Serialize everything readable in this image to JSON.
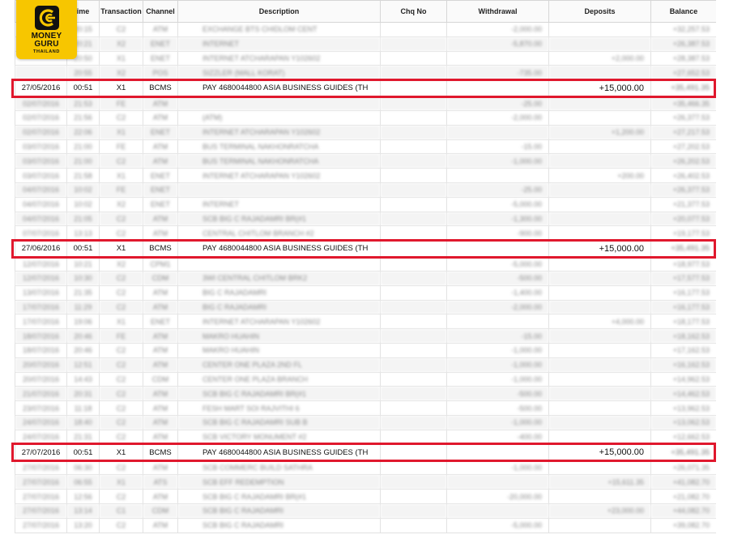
{
  "brand": {
    "line1": "MONEY",
    "line2": "GURU",
    "line3": "THAILAND"
  },
  "headers": [
    "ime",
    "Transaction",
    "Channel",
    "Description",
    "Chq No",
    "Withdrawal",
    "Deposits",
    "Balance"
  ],
  "colors": {
    "highlight": "#e0182d",
    "brand": "#f7c600"
  },
  "rows": [
    {
      "date": "",
      "time": "20:15",
      "trn": "C2",
      "chn": "ATM",
      "desc": "EXCHANGE BTS CHIDLOM CENT",
      "chq": "",
      "wd": "-2,000.00",
      "dep": "",
      "bal": "+32,257.53",
      "hl": false
    },
    {
      "date": "",
      "time": "20:21",
      "trn": "X2",
      "chn": "ENET",
      "desc": "INTERNET",
      "chq": "",
      "wd": "-5,870.00",
      "dep": "",
      "bal": "+26,387.53",
      "hl": false
    },
    {
      "date": "",
      "time": "20:50",
      "trn": "X1",
      "chn": "ENET",
      "desc": "INTERNET ATCHARAPAN Y102602",
      "chq": "",
      "wd": "",
      "dep": "+2,000.00",
      "bal": "+28,387.53",
      "hl": false
    },
    {
      "date": "",
      "time": "20:55",
      "trn": "X2",
      "chn": "POS",
      "desc": "SIZZLER (MALL KORAT)",
      "chq": "",
      "wd": "-735.00",
      "dep": "",
      "bal": "+27,652.53",
      "hl": false
    },
    {
      "date": "27/05/2016",
      "time": "00:51",
      "trn": "X1",
      "chn": "BCMS",
      "desc": "PAY 4680044800 ASIA BUSINESS GUIDES (TH",
      "chq": "",
      "wd": "",
      "dep": "+15,000.00",
      "bal": "+35,491.35",
      "hl": true
    },
    {
      "date": "02/07/2016",
      "time": "21:53",
      "trn": "FE",
      "chn": "ATM",
      "desc": "",
      "chq": "",
      "wd": "-25.00",
      "dep": "",
      "bal": "+35,466.35",
      "hl": false
    },
    {
      "date": "02/07/2016",
      "time": "21:56",
      "trn": "C2",
      "chn": "ATM",
      "desc": "(ATM)",
      "chq": "",
      "wd": "-2,000.00",
      "dep": "",
      "bal": "+26,377.53",
      "hl": false
    },
    {
      "date": "02/07/2016",
      "time": "22:06",
      "trn": "X1",
      "chn": "ENET",
      "desc": "INTERNET ATCHARAPAN Y102602",
      "chq": "",
      "wd": "",
      "dep": "+1,200.00",
      "bal": "+27,217.53",
      "hl": false
    },
    {
      "date": "03/07/2016",
      "time": "21:00",
      "trn": "FE",
      "chn": "ATM",
      "desc": "BUS TERMINAL NAKHONRATCHA",
      "chq": "",
      "wd": "-15.00",
      "dep": "",
      "bal": "+27,202.53",
      "hl": false
    },
    {
      "date": "03/07/2016",
      "time": "21:00",
      "trn": "C2",
      "chn": "ATM",
      "desc": "BUS TERMINAL NAKHONRATCHA",
      "chq": "",
      "wd": "-1,000.00",
      "dep": "",
      "bal": "+26,202.53",
      "hl": false
    },
    {
      "date": "03/07/2016",
      "time": "21:58",
      "trn": "X1",
      "chn": "ENET",
      "desc": "INTERNET ATCHARAPAN Y102602",
      "chq": "",
      "wd": "",
      "dep": "+200.00",
      "bal": "+26,402.53",
      "hl": false
    },
    {
      "date": "04/07/2016",
      "time": "10:02",
      "trn": "FE",
      "chn": "ENET",
      "desc": "",
      "chq": "",
      "wd": "-25.00",
      "dep": "",
      "bal": "+26,377.53",
      "hl": false
    },
    {
      "date": "04/07/2016",
      "time": "10:02",
      "trn": "X2",
      "chn": "ENET",
      "desc": "INTERNET",
      "chq": "",
      "wd": "-5,000.00",
      "dep": "",
      "bal": "+21,377.53",
      "hl": false
    },
    {
      "date": "04/07/2016",
      "time": "21:05",
      "trn": "C2",
      "chn": "ATM",
      "desc": "SCB BIG C RAJADAMRI BR(#1",
      "chq": "",
      "wd": "-1,300.00",
      "dep": "",
      "bal": "+20,077.53",
      "hl": false
    },
    {
      "date": "07/07/2016",
      "time": "13:13",
      "trn": "C2",
      "chn": "ATM",
      "desc": "CENTRAL CHITLOM BRANCH #2",
      "chq": "",
      "wd": "-900.00",
      "dep": "",
      "bal": "+19,177.53",
      "hl": false
    },
    {
      "date": "27/06/2016",
      "time": "00:51",
      "trn": "X1",
      "chn": "BCMS",
      "desc": "PAY 4680044800 ASIA BUSINESS GUIDES (TH",
      "chq": "",
      "wd": "",
      "dep": "+15,000.00",
      "bal": "+35,491.35",
      "hl": true
    },
    {
      "date": "12/07/2016",
      "time": "10:21",
      "trn": "X2",
      "chn": "CPM1",
      "desc": "",
      "chq": "",
      "wd": "-5,000.00",
      "dep": "",
      "bal": "+18,977.53",
      "hl": false
    },
    {
      "date": "12/07/2016",
      "time": "10:30",
      "trn": "C2",
      "chn": "CDM",
      "desc": "3WI CENTRAL CHITLOM BRK2",
      "chq": "",
      "wd": "-500.00",
      "dep": "",
      "bal": "+17,577.53",
      "hl": false
    },
    {
      "date": "13/07/2016",
      "time": "21:35",
      "trn": "C2",
      "chn": "ATM",
      "desc": "BIG C RAJADAMRI",
      "chq": "",
      "wd": "-1,400.00",
      "dep": "",
      "bal": "+16,177.53",
      "hl": false
    },
    {
      "date": "17/07/2016",
      "time": "11:29",
      "trn": "C2",
      "chn": "ATM",
      "desc": "BIG C RAJADAMRI",
      "chq": "",
      "wd": "-2,000.00",
      "dep": "",
      "bal": "+16,177.53",
      "hl": false
    },
    {
      "date": "17/07/2016",
      "time": "19:06",
      "trn": "X1",
      "chn": "ENET",
      "desc": "INTERNET ATCHARAPAN Y102602",
      "chq": "",
      "wd": "",
      "dep": "+4,000.00",
      "bal": "+18,177.53",
      "hl": false
    },
    {
      "date": "18/07/2016",
      "time": "20:46",
      "trn": "FE",
      "chn": "ATM",
      "desc": "MAKRO HUAHIN",
      "chq": "",
      "wd": "-15.00",
      "dep": "",
      "bal": "+18,162.53",
      "hl": false
    },
    {
      "date": "18/07/2016",
      "time": "20:46",
      "trn": "C2",
      "chn": "ATM",
      "desc": "MAKRO HUAHIN",
      "chq": "",
      "wd": "-1,000.00",
      "dep": "",
      "bal": "+17,162.53",
      "hl": false
    },
    {
      "date": "20/07/2016",
      "time": "12:51",
      "trn": "C2",
      "chn": "ATM",
      "desc": "CENTER ONE PLAZA 2ND FL",
      "chq": "",
      "wd": "-1,000.00",
      "dep": "",
      "bal": "+16,162.53",
      "hl": false
    },
    {
      "date": "20/07/2016",
      "time": "14:43",
      "trn": "C2",
      "chn": "CDM",
      "desc": "CENTER ONE PLAZA BRANCH",
      "chq": "",
      "wd": "-1,000.00",
      "dep": "",
      "bal": "+14,962.53",
      "hl": false
    },
    {
      "date": "21/07/2016",
      "time": "20:31",
      "trn": "C2",
      "chn": "ATM",
      "desc": "SCB BIG C RAJADAMRI BR(#1",
      "chq": "",
      "wd": "-500.00",
      "dep": "",
      "bal": "+14,462.53",
      "hl": false
    },
    {
      "date": "23/07/2016",
      "time": "11:18",
      "trn": "C2",
      "chn": "ATM",
      "desc": "FESH MART SOI RAJVITHI 6",
      "chq": "",
      "wd": "-500.00",
      "dep": "",
      "bal": "+13,962.53",
      "hl": false
    },
    {
      "date": "24/07/2016",
      "time": "18:40",
      "trn": "C2",
      "chn": "ATM",
      "desc": "SCB BIG C RAJADAMRI SUB B",
      "chq": "",
      "wd": "-1,000.00",
      "dep": "",
      "bal": "+13,062.53",
      "hl": false
    },
    {
      "date": "24/07/2016",
      "time": "21:31",
      "trn": "C2",
      "chn": "ATM",
      "desc": "SCB VICTORY MONUMENT #2",
      "chq": "",
      "wd": "-400.00",
      "dep": "",
      "bal": "+12,662.53",
      "hl": false
    },
    {
      "date": "27/07/2016",
      "time": "00:51",
      "trn": "X1",
      "chn": "BCMS",
      "desc": "PAY 4680044800 ASIA BUSINESS GUIDES (TH",
      "chq": "",
      "wd": "",
      "dep": "+15,000.00",
      "bal": "+35,491.35",
      "hl": true
    },
    {
      "date": "27/07/2016",
      "time": "06:30",
      "trn": "C2",
      "chn": "ATM",
      "desc": "SCB COMMERC BUILD SATHRA",
      "chq": "",
      "wd": "-1,000.00",
      "dep": "",
      "bal": "+26,071.35",
      "hl": false
    },
    {
      "date": "27/07/2016",
      "time": "06:55",
      "trn": "X1",
      "chn": "ATS",
      "desc": "SCB EFF REDEMPTION",
      "chq": "",
      "wd": "",
      "dep": "+15,611.35",
      "bal": "+41,082.70",
      "hl": false
    },
    {
      "date": "27/07/2016",
      "time": "12:56",
      "trn": "C2",
      "chn": "ATM",
      "desc": "SCB BIG C RAJADAMRI BR(#1",
      "chq": "",
      "wd": "-20,000.00",
      "dep": "",
      "bal": "+21,082.70",
      "hl": false
    },
    {
      "date": "27/07/2016",
      "time": "13:14",
      "trn": "C1",
      "chn": "CDM",
      "desc": "SCB BIG C RAJADAMRI",
      "chq": "",
      "wd": "",
      "dep": "+23,000.00",
      "bal": "+44,082.70",
      "hl": false
    },
    {
      "date": "27/07/2016",
      "time": "13:20",
      "trn": "C2",
      "chn": "ATM",
      "desc": "SCB BIG C RAJADAMRI",
      "chq": "",
      "wd": "-5,000.00",
      "dep": "",
      "bal": "+39,082.70",
      "hl": false
    }
  ]
}
